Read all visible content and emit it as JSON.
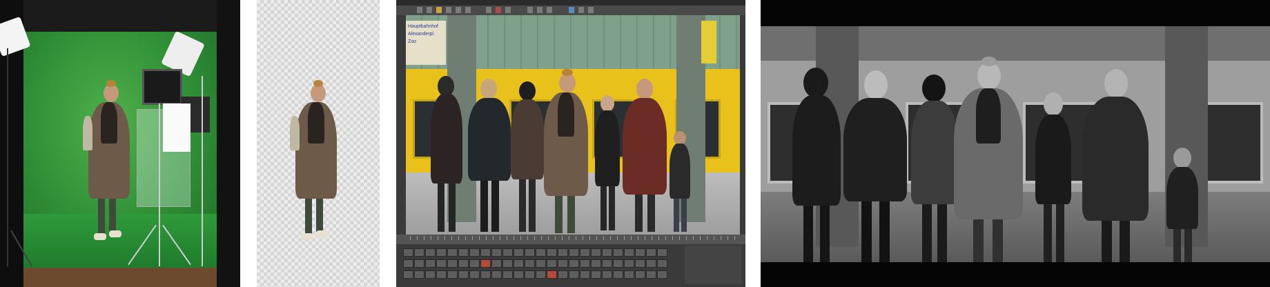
{
  "panels": [
    {
      "id": "green-screen-shot",
      "description_kind": "photo"
    },
    {
      "id": "cutout-on-transparency",
      "description_kind": "photo"
    },
    {
      "id": "compositing-software",
      "description_kind": "screenshot"
    },
    {
      "id": "final-bw-composite",
      "description_kind": "photo"
    }
  ],
  "sign_text": {
    "line1": "Hauptbahnhof",
    "line2": "Alexanderpl.",
    "line3": "Zoo"
  },
  "colors": {
    "green_screen": "#2f8f36",
    "train_yellow": "#e8c21a",
    "checker_light": "#ececec",
    "checker_dark": "#d6d6d6"
  }
}
